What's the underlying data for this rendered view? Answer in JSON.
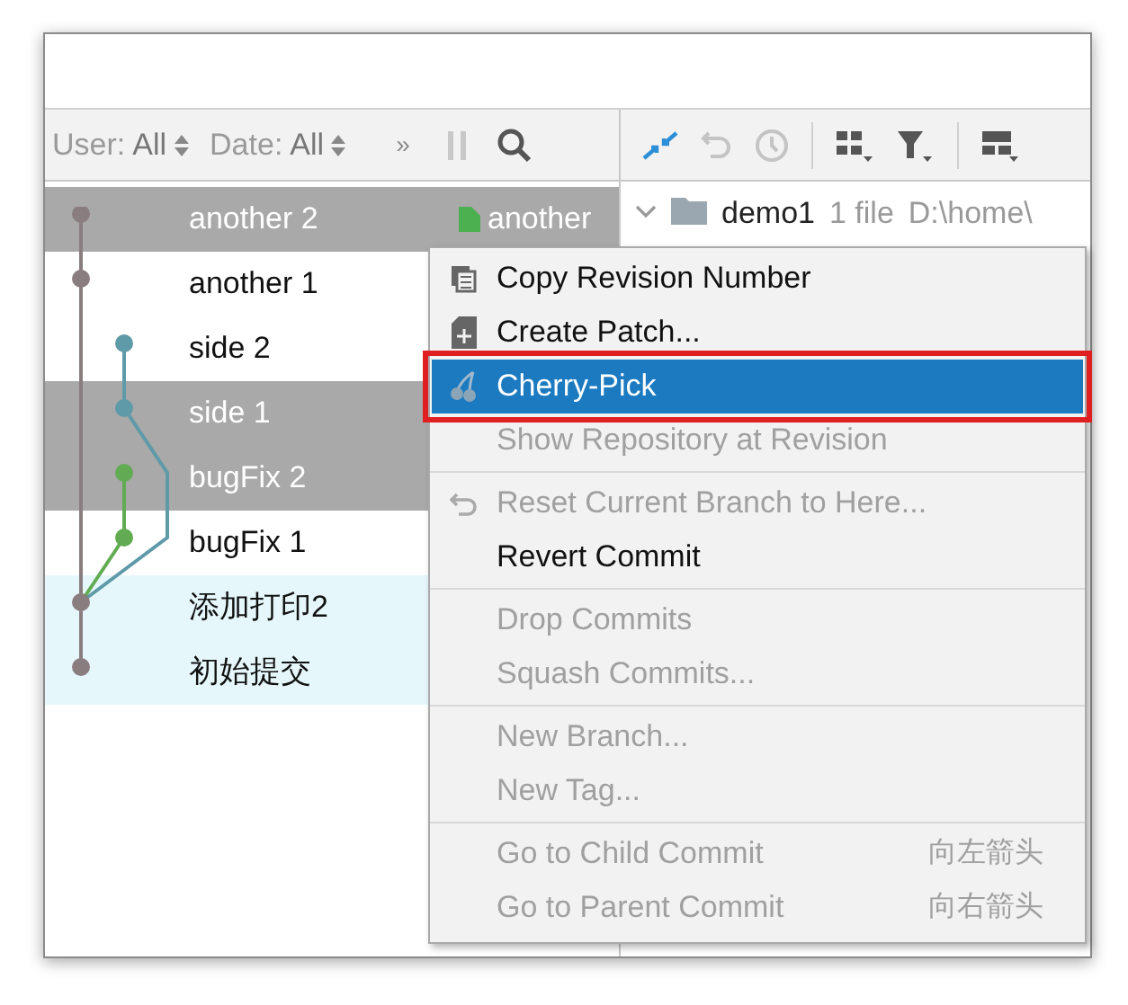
{
  "toolbar": {
    "user_filter": {
      "label": "User:",
      "value": "All"
    },
    "date_filter": {
      "label": "Date:",
      "value": "All"
    },
    "more": "»"
  },
  "commits": [
    {
      "subject": "another 2",
      "selected": true,
      "highlighted": false,
      "tag": "another"
    },
    {
      "subject": "another 1",
      "selected": false,
      "highlighted": false
    },
    {
      "subject": "side 2",
      "selected": false,
      "highlighted": false
    },
    {
      "subject": "side 1",
      "selected": true,
      "highlighted": false
    },
    {
      "subject": "bugFix 2",
      "selected": true,
      "highlighted": false
    },
    {
      "subject": "bugFix 1",
      "selected": false,
      "highlighted": false
    },
    {
      "subject": "添加打印2",
      "selected": false,
      "highlighted": true
    },
    {
      "subject": "初始提交",
      "selected": false,
      "highlighted": true
    }
  ],
  "changes": {
    "folder": "demo1",
    "count": "1 file",
    "path": "D:\\home\\"
  },
  "context_menu": [
    [
      {
        "label": "Copy Revision Number",
        "kind": "copy",
        "disabled": false,
        "selected": false,
        "marked": false
      },
      {
        "label": "Create Patch...",
        "kind": "patch",
        "disabled": false,
        "selected": false,
        "marked": false
      },
      {
        "label": "Cherry-Pick",
        "kind": "cherry",
        "disabled": false,
        "selected": true,
        "marked": true
      },
      {
        "label": "Show Repository at Revision",
        "disabled": true,
        "selected": false,
        "marked": false
      }
    ],
    [
      {
        "label": "Reset Current Branch to Here...",
        "kind": "undo",
        "disabled": true,
        "selected": false,
        "marked": false
      },
      {
        "label": "Revert Commit",
        "disabled": false,
        "selected": false,
        "marked": false
      }
    ],
    [
      {
        "label": "Drop Commits",
        "disabled": true,
        "selected": false,
        "marked": false
      },
      {
        "label": "Squash Commits...",
        "disabled": true,
        "selected": false,
        "marked": false
      }
    ],
    [
      {
        "label": "New Branch...",
        "disabled": true,
        "selected": false,
        "marked": false
      },
      {
        "label": "New Tag...",
        "disabled": true,
        "selected": false,
        "marked": false
      }
    ],
    [
      {
        "label": "Go to Child Commit",
        "shortcut": "向左箭头",
        "disabled": true,
        "selected": false,
        "marked": false
      },
      {
        "label": "Go to Parent Commit",
        "shortcut": "向右箭头",
        "disabled": true,
        "selected": false,
        "marked": false
      }
    ]
  ]
}
